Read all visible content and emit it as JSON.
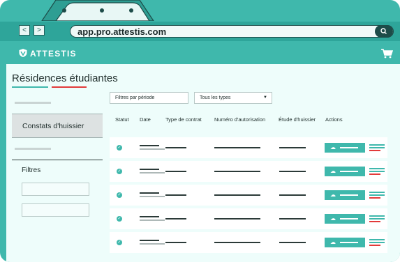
{
  "browser": {
    "url": "app.pro.attestis.com",
    "back_icon": "<",
    "forward_icon": ">"
  },
  "app": {
    "brand": "ATTESTIS",
    "page_title": "Résidences étudiantes"
  },
  "sidebar": {
    "active_item": "Constats d'huissier",
    "filters_label": "Filtres"
  },
  "filters": {
    "period_placeholder": "Filtres par période",
    "type_select": "Tous les types",
    "type_arrow": "▼"
  },
  "table": {
    "headers": [
      "Statut",
      "Date",
      "Type de contrat",
      "Numéro d'autorisation",
      "Étude d'huissier",
      "Actions"
    ],
    "row_count": 5,
    "status_glyph": "✓"
  },
  "colors": {
    "accent": "#3fb8ac",
    "danger": "#e23a3a",
    "dark": "#1d4c49"
  }
}
